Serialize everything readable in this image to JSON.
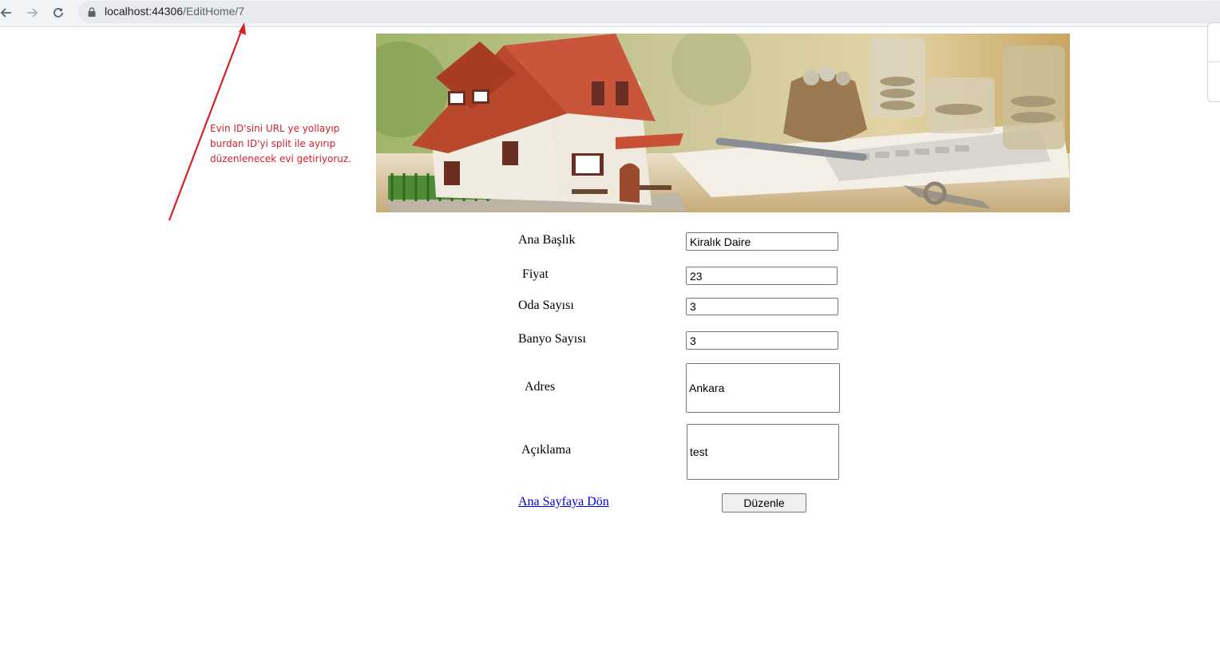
{
  "browser": {
    "url_host": "localhost:44306",
    "url_path": "/EditHome/7",
    "icons": [
      "back-arrow-icon",
      "forward-arrow-icon",
      "reload-icon",
      "lock-icon"
    ]
  },
  "annotation": {
    "lines": [
      "Evin ID'sini URL ye yollayıp",
      "burdan ID'yi split ile ayırıp",
      "düzenlenecek evi getiriyoruz."
    ],
    "color": "#d6212a"
  },
  "form": {
    "title_label": "Ana Başlık",
    "title_value": "Kiralık Daire",
    "price_label": "Fiyat",
    "price_value": "23",
    "rooms_label": "Oda Sayısı",
    "rooms_value": "3",
    "baths_label": "Banyo Sayısı",
    "baths_value": "3",
    "address_label": "Adres",
    "address_value": "Ankara",
    "description_label": "Açıklama",
    "description_value": "test",
    "home_link": "Ana Sayfaya Dön",
    "submit_label": "Düzenle"
  },
  "colors": {
    "link": "#0000ee",
    "chrome": "#f1f3f4"
  }
}
